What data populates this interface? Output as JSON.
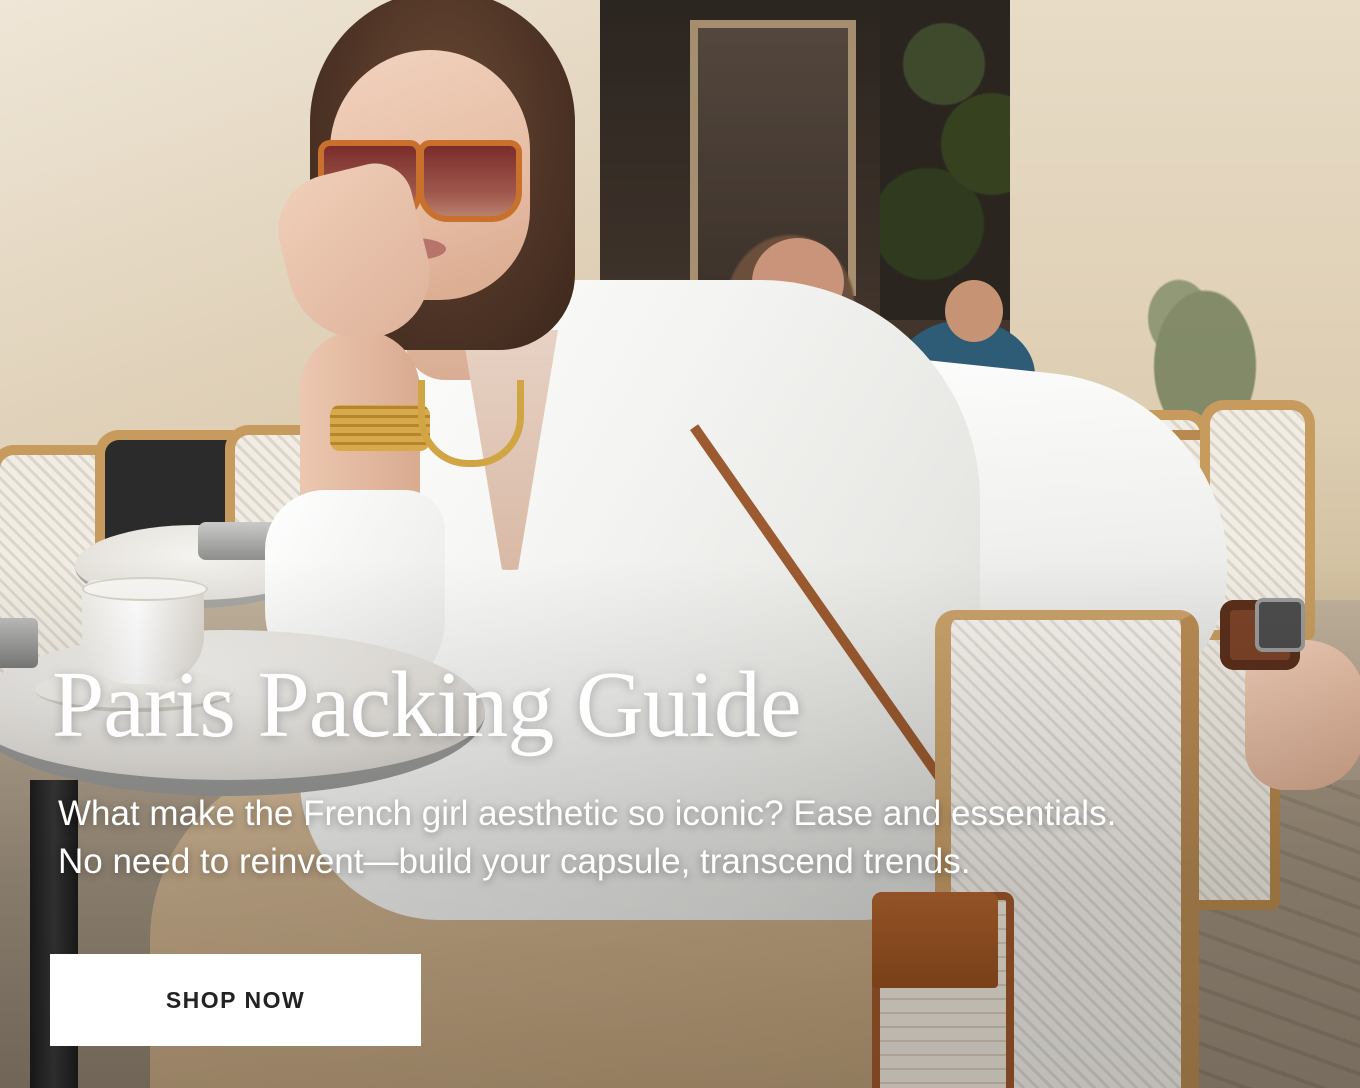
{
  "hero": {
    "title": "Paris Packing Guide",
    "subtitle_lines": [
      "What make the French girl aesthetic so iconic? Ease and essentials.",
      "No need to reinvent—build your capsule, transcend trends."
    ],
    "cta_label": "SHOP NOW",
    "image_alt": "Woman in a white shirt and sunglasses seated at a Paris café table"
  },
  "colors": {
    "text": "#ffffff",
    "button_bg": "#ffffff",
    "button_text": "#222222"
  }
}
